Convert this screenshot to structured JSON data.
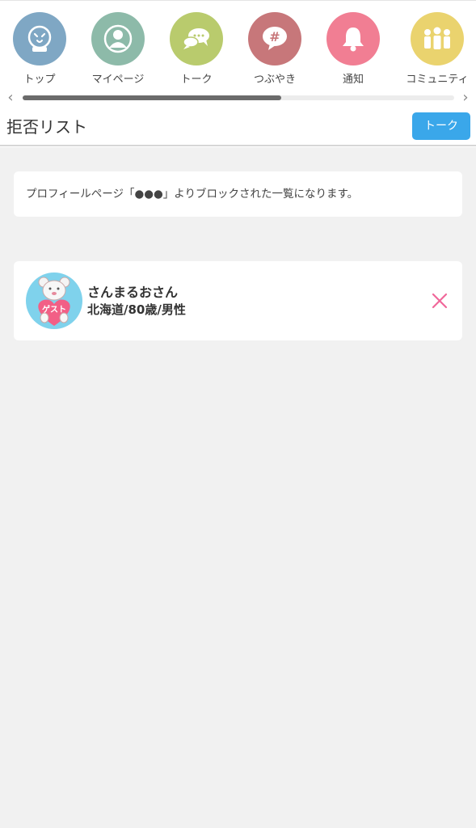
{
  "nav": {
    "items": [
      {
        "label": "トップ",
        "icon": "top-face-icon",
        "color": "#7fa7c4"
      },
      {
        "label": "マイページ",
        "icon": "person-icon",
        "color": "#8dbaa9"
      },
      {
        "label": "トーク",
        "icon": "chat-bubbles-icon",
        "color": "#b9cb6d"
      },
      {
        "label": "つぶやき",
        "icon": "hashtag-bubble-icon",
        "color": "#c7777a"
      },
      {
        "label": "通知",
        "icon": "bell-icon",
        "color": "#f17e93"
      },
      {
        "label": "コミュニティ",
        "icon": "group-icon",
        "color": "#ead36e"
      }
    ],
    "scroll_left": "‹",
    "scroll_right": "›",
    "scroll_progress": 0.6
  },
  "page": {
    "title": "拒否リスト",
    "talk_button": "トーク"
  },
  "info": {
    "text": "プロフィールページ「●●●」よりブロックされた一覧になります。"
  },
  "blocked_users": [
    {
      "name": "さんまるおさん",
      "details": "北海道/80歳/男性",
      "avatar_badge": "ゲスト",
      "avatar_icon": "guest-bear-icon"
    }
  ],
  "colors": {
    "accent": "#3aa7ea",
    "remove": "#f0679a",
    "background": "#f1f1f1"
  }
}
